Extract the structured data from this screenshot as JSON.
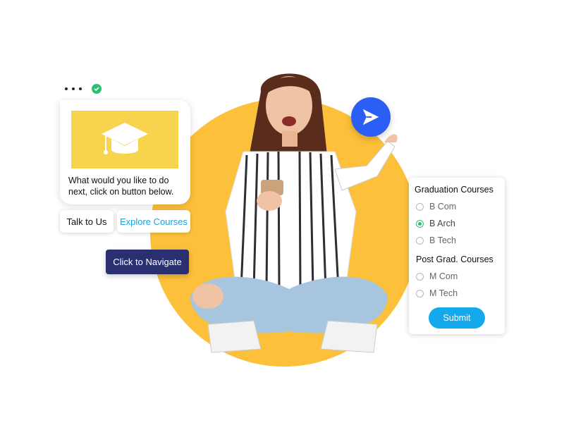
{
  "colors": {
    "accent_yellow": "#fcc03a",
    "send_blue": "#2b5ef5",
    "navigate_navy": "#2a2f70",
    "submit_blue": "#13a9ec",
    "explore_text": "#18a3de",
    "selected_green": "#2fbf71"
  },
  "chat": {
    "message": "What would you like to do next, click on button below.",
    "banner_icon": "graduation-cap-icon",
    "status_icon": "verified-check-icon",
    "quick_replies": {
      "talk": "Talk to Us",
      "explore": "Explore Courses"
    },
    "navigate_label": "Click to Navigate"
  },
  "form": {
    "graduation_title": "Graduation Courses",
    "graduation_options": [
      "B Com",
      "B Arch",
      "B Tech"
    ],
    "graduation_selected": "B Arch",
    "postgrad_title": "Post Grad. Courses",
    "postgrad_options": [
      "M Com",
      "M Tech"
    ],
    "submit_label": "Submit"
  },
  "send_icon": "send-paper-plane-icon"
}
